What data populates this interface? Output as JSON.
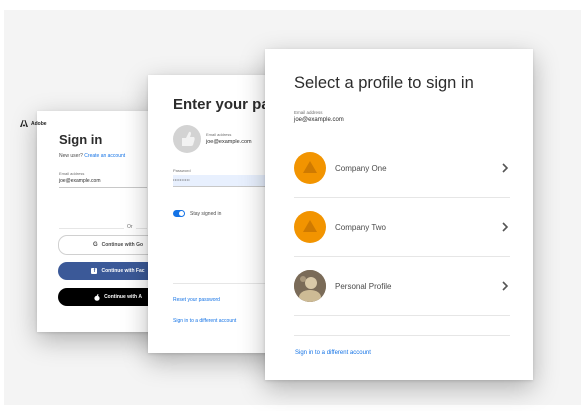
{
  "card_signin": {
    "brand": "Adobe",
    "title": "Sign in",
    "new_user_prefix": "New user?",
    "create_account": "Create an account",
    "email_label": "Email address",
    "email_value": "joe@example.com",
    "or": "Or",
    "google": "Continue with Go",
    "facebook": "Continue with Fac",
    "apple": "Continue with A"
  },
  "card_password": {
    "title": "Enter your pas",
    "email_label": "Email address",
    "email_value": "joe@example.com",
    "password_label": "Password",
    "password_value": "••••••••••",
    "stay_signed_in": "Stay signed in",
    "reset": "Reset your password",
    "different": "Sign in to a different account"
  },
  "card_profile": {
    "title": "Select a profile to sign in",
    "email_label": "Email address",
    "email_value": "joe@example.com",
    "profiles": [
      {
        "name": "Company One"
      },
      {
        "name": "Company Two"
      },
      {
        "name": "Personal Profile"
      }
    ],
    "different": "Sign in to a different account"
  },
  "colors": {
    "accent": "#1473e6",
    "facebook": "#3b5998",
    "apple": "#000000",
    "company_orange": "#f29400"
  }
}
